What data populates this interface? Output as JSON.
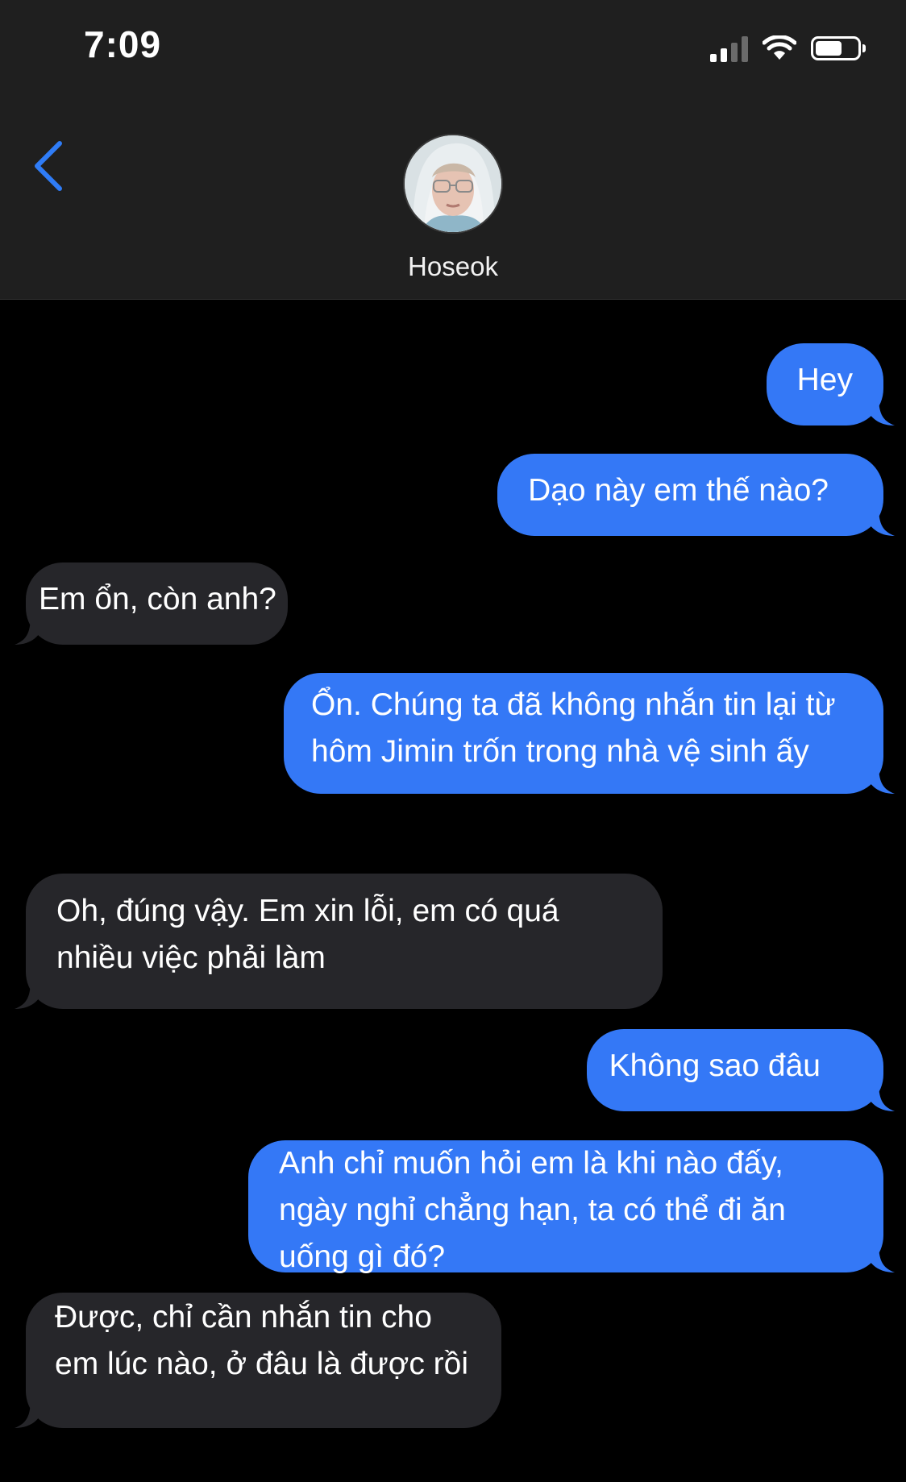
{
  "status_bar": {
    "time": "7:09"
  },
  "header": {
    "contact_name": "Hoseok"
  },
  "colors": {
    "sent_bubble": "#3478f6",
    "received_bubble": "#26262a",
    "accent": "#2f7cf6",
    "background": "#000000",
    "header_background": "#1f1f1f"
  },
  "messages": [
    {
      "direction": "sent",
      "text": "Hey"
    },
    {
      "direction": "sent",
      "text": "Dạo này em thế nào?"
    },
    {
      "direction": "received",
      "text": "Em ổn, còn anh?"
    },
    {
      "direction": "sent",
      "text": "Ổn. Chúng ta đã không nhắn tin lại từ hôm Jimin trốn trong nhà vệ sinh ấy"
    },
    {
      "direction": "received",
      "text": "Oh, đúng vậy. Em xin lỗi, em có quá nhiều việc phải làm"
    },
    {
      "direction": "sent",
      "text": "Không sao đâu"
    },
    {
      "direction": "sent",
      "text": "Anh chỉ muốn hỏi em là khi nào đấy, ngày nghỉ chẳng hạn, ta có thể đi ăn uống gì đó?"
    },
    {
      "direction": "received",
      "text": "Được, chỉ cần nhắn tin cho em lúc nào, ở đâu là được rồi"
    }
  ]
}
